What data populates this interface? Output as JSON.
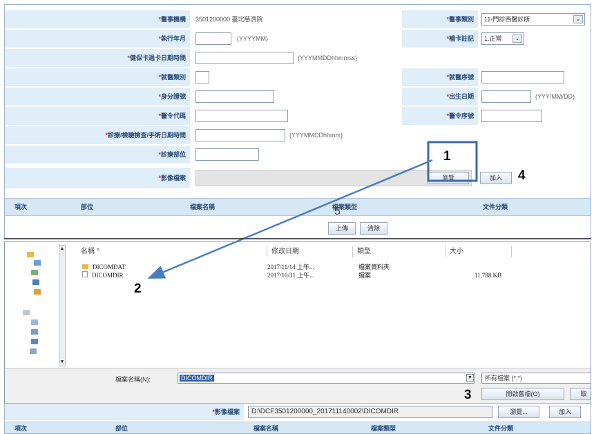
{
  "form": {
    "fields": {
      "hospital_code": {
        "label": "醫事機構",
        "value": "3501200000 臺北慈濟院"
      },
      "hospital_type": {
        "label": "醫事類別",
        "value": "11-門診西醫診所"
      },
      "exec_year_month": {
        "label": "執行年月",
        "hint": "(YYYYMM)"
      },
      "card_note": {
        "label": "補卡註記",
        "value": "1.正常"
      },
      "card_time": {
        "label": "健保卡過卡日期時間",
        "hint": "(YYYMMDDhhmmss)"
      },
      "visit_type": {
        "label": "就醫類別"
      },
      "visit_seq": {
        "label": "就醫序號"
      },
      "id_no": {
        "label": "身分證號"
      },
      "birth_date": {
        "label": "出生日期",
        "hint": "(YYY/MM/DD)"
      },
      "order_code": {
        "label": "醫令代碼"
      },
      "order_seq": {
        "label": "醫令序號"
      },
      "exam_time": {
        "label": "診療/檢驗檢查/手術日期時間",
        "hint": "(YYYMMDDhhmm)"
      },
      "body_part": {
        "label": "診療部位"
      },
      "image_file": {
        "label": "影像檔案"
      }
    },
    "required_mark": "*",
    "browse_label": "瀏覽",
    "add_label": "加入",
    "table_headers": [
      "項次",
      "部位",
      "檔案名稱",
      "檔案類型",
      "文件分類"
    ],
    "upload_label": "上傳",
    "clear_label": "清除"
  },
  "dialog": {
    "columns": [
      "名稱",
      "修改日期",
      "類型",
      "大小"
    ],
    "sort_indicator": "^",
    "files": [
      {
        "name": "DICOMDAT",
        "date": "2017/11/14 上午...",
        "type": "檔案資料夾",
        "size": ""
      },
      {
        "name": "DICOMDIR",
        "date": "2017/10/31 上午...",
        "type": "檔案",
        "size": "11,788 KB"
      }
    ],
    "filename_label": "檔案名稱(N):",
    "filename_value": "DICOMDIR",
    "filetype_value": "所有檔案 (*.*)",
    "open_label": "開啟舊檔(O)",
    "cancel_label": "取"
  },
  "bottom": {
    "image_file_label": "影像檔案",
    "path_value": "D:\\DCF3501200000_201711140002\\DICOMDIR",
    "browse_label": "瀏覽...",
    "add_label": "加入",
    "table_headers": [
      "項次",
      "部位",
      "檔案名稱",
      "檔案類型",
      "文件分類"
    ]
  },
  "annotations": {
    "n1": "1",
    "n2": "2",
    "n3": "3",
    "n4": "4",
    "n5": "5"
  },
  "colors": {
    "label_bg": "#dfeef8",
    "label_text": "#2b4d7a",
    "required": "#d2322d",
    "arrow": "#4a7cc0",
    "highlight_box": "#3a6bb0"
  }
}
